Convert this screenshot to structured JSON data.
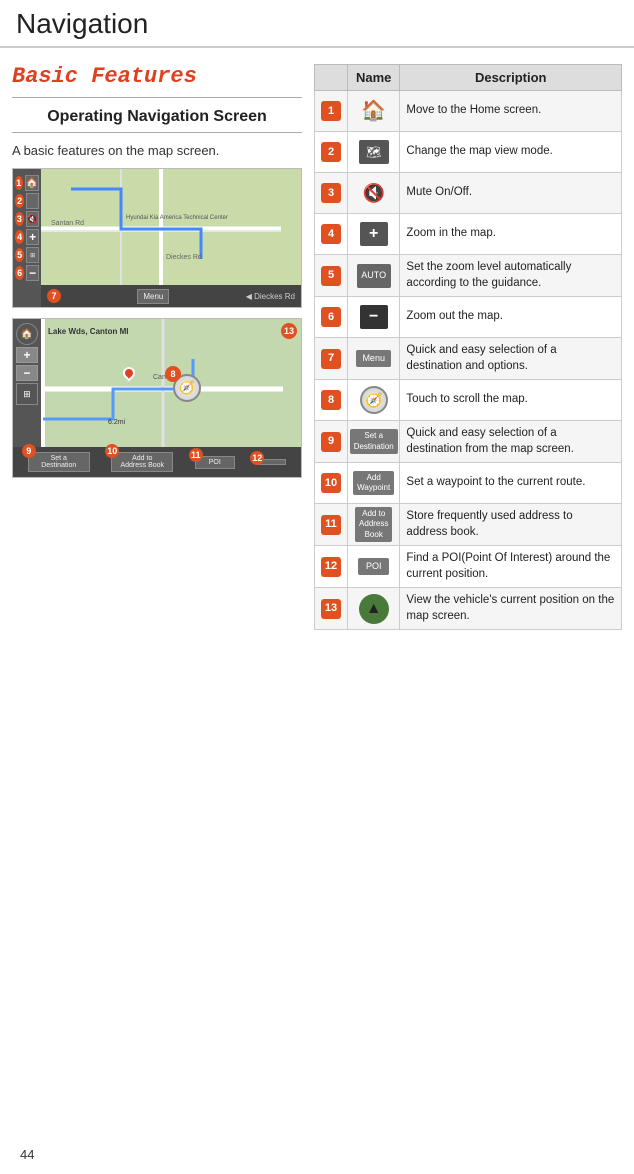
{
  "header": {
    "title": "Navigation",
    "page_number": "44"
  },
  "left": {
    "section_title": "Basic Features",
    "subsection_title": "Operating Navigation Screen",
    "description": "A basic features on the map screen."
  },
  "table": {
    "col_name": "Name",
    "col_description": "Description",
    "rows": [
      {
        "num": "1",
        "icon_type": "home",
        "desc": "Move to the Home screen."
      },
      {
        "num": "2",
        "icon_type": "map_mode",
        "desc": "Change the map view mode."
      },
      {
        "num": "3",
        "icon_type": "mute",
        "desc": "Mute On/Off."
      },
      {
        "num": "4",
        "icon_type": "zoom_in",
        "desc": "Zoom in the map."
      },
      {
        "num": "5",
        "icon_type": "auto_zoom",
        "desc": "Set the zoom level automatically according to the guidance."
      },
      {
        "num": "6",
        "icon_type": "zoom_out",
        "desc": "Zoom out the map."
      },
      {
        "num": "7",
        "icon_type": "menu_btn",
        "icon_label": "Menu",
        "desc": "Quick and easy selection of a destination and options."
      },
      {
        "num": "8",
        "icon_type": "compass",
        "desc": "Touch to scroll the map."
      },
      {
        "num": "9",
        "icon_type": "set_dest_btn",
        "icon_label": "Set a\nDestination",
        "desc": "Quick and easy selection of a destination from the map screen."
      },
      {
        "num": "10",
        "icon_type": "add_wp_btn",
        "icon_label": "Add\nWaypoint",
        "desc": "Set a waypoint to the current route."
      },
      {
        "num": "11",
        "icon_type": "add_addr_btn",
        "icon_label": "Add to\nAddress Book",
        "desc": "Store frequently used address to address book."
      },
      {
        "num": "12",
        "icon_type": "poi_btn",
        "icon_label": "POI",
        "desc": "Find a POI(Point Of Interest) around the current position."
      },
      {
        "num": "13",
        "icon_type": "nav_arrow",
        "desc": "View the vehicle's current position on the map screen."
      }
    ]
  },
  "map1": {
    "labels": [
      "1",
      "2",
      "3",
      "4",
      "5",
      "6",
      "7"
    ],
    "road_text": [
      "Hyundai Kia America Technical Center",
      "Santan Rd",
      "Dieckes Rd"
    ]
  },
  "map2": {
    "labels": [
      "8",
      "9",
      "10",
      "11",
      "12",
      "13"
    ],
    "location_text": "Lake Wds, Canton MI",
    "bottom_buttons": [
      "Set a\nDestination",
      "Add to\nAddress Book",
      "POI",
      ""
    ]
  }
}
